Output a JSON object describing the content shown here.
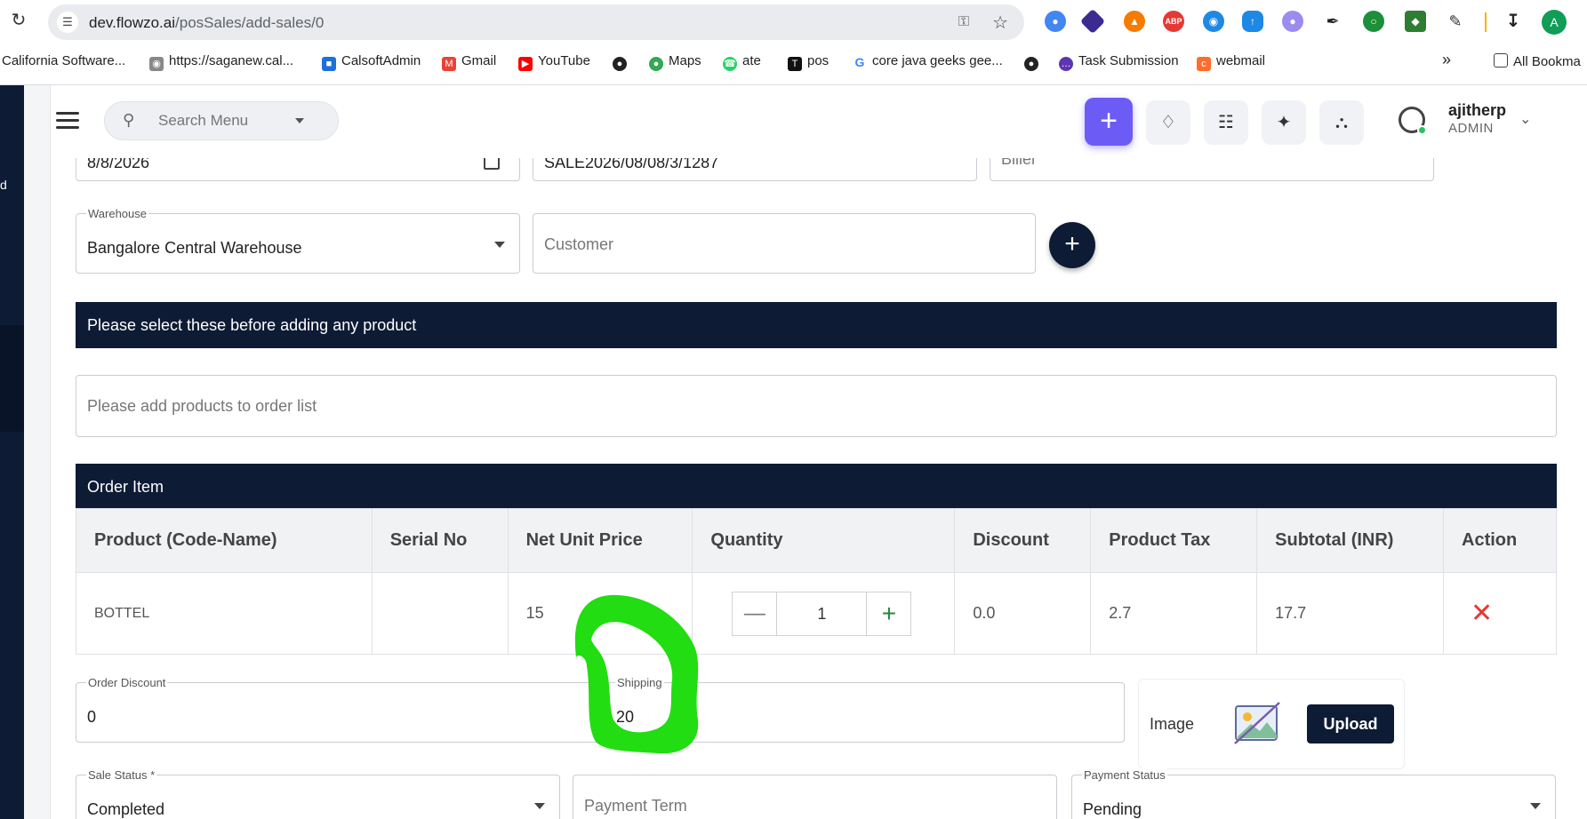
{
  "browser": {
    "url_host": "dev.flowzo.ai",
    "url_path": "/posSales/add-sales/0",
    "profile_initial": "A",
    "bookmarks": [
      {
        "label": "California Software..."
      },
      {
        "label": "https://saganew.cal..."
      },
      {
        "label": "CalsoftAdmin"
      },
      {
        "label": "Gmail"
      },
      {
        "label": "YouTube"
      },
      {
        "label": ""
      },
      {
        "label": "Maps"
      },
      {
        "label": "ate"
      },
      {
        "label": "pos"
      },
      {
        "label": "core java geeks gee..."
      },
      {
        "label": ""
      },
      {
        "label": "Task Submission"
      },
      {
        "label": "webmail"
      }
    ],
    "more_bookmarks": "»",
    "all_bookmarks": "All Bookma"
  },
  "sidebar": {
    "partial_letter": "d"
  },
  "topbar": {
    "search_placeholder": "Search Menu",
    "user_name": "ajitherp",
    "user_role": "ADMIN"
  },
  "form": {
    "date_value": "8/8/2026",
    "reference_value": "SALE2026/08/08/3/1287",
    "biller_placeholder": "Biller",
    "warehouse_label": "Warehouse",
    "warehouse_value": "Bangalore Central Warehouse",
    "customer_placeholder": "Customer",
    "select_notice": "Please select these before adding any product",
    "products_placeholder": "Please add products to order list",
    "order_item_title": "Order Item",
    "order_discount_label": "Order Discount",
    "order_discount_value": "0",
    "shipping_label": "Shipping",
    "shipping_value": "20",
    "image_label": "Image",
    "upload_label": "Upload",
    "sale_status_label": "Sale Status *",
    "sale_status_value": "Completed",
    "payment_term_placeholder": "Payment Term",
    "payment_status_label": "Payment Status",
    "payment_status_value": "Pending"
  },
  "table": {
    "headers": [
      "Product (Code-Name)",
      "Serial No",
      "Net Unit Price",
      "Quantity",
      "Discount",
      "Product Tax",
      "Subtotal (INR)",
      "Action"
    ],
    "rows": [
      {
        "product": "BOTTEL",
        "serial": "",
        "net_unit_price": "15",
        "quantity": "1",
        "discount": "0.0",
        "product_tax": "2.7",
        "subtotal": "17.7"
      }
    ]
  },
  "colors": {
    "primary_navy": "#0d1b34",
    "accent_purple": "#6c5cf5",
    "annotation_green": "#22dd11",
    "remove_red": "#e53935"
  }
}
